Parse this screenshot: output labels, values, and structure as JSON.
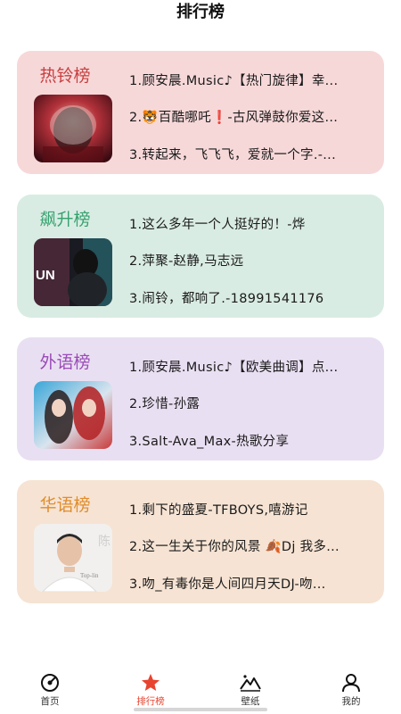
{
  "header": {
    "title": "排行榜"
  },
  "charts": [
    {
      "title": "热铃榜",
      "title_color": "#c84040",
      "background": "#f7d8d9",
      "songs": [
        "1.顾安晨.Music♪【热门旋律】幸...",
        "2.🐯百酷哪吒❗-古风弹鼓你爱这...",
        "3.转起来，飞飞飞，爱就一个字.-..."
      ]
    },
    {
      "title": "飙升榜",
      "title_color": "#36a26f",
      "background": "#d9ece3",
      "songs": [
        "1.这么多年一个人挺好的！-烨",
        "2.萍聚-赵静,马志远",
        "3.闹铃，都响了.-18991541176"
      ]
    },
    {
      "title": "外语榜",
      "title_color": "#9a4bb8",
      "background": "#e9dff2",
      "songs": [
        "1.顾安晨.Music♪【欧美曲调】点...",
        "2.珍惜-孙露",
        "3.Salt-Ava_Max-热歌分享"
      ]
    },
    {
      "title": "华语榜",
      "title_color": "#e08d2c",
      "background": "#f6e3d3",
      "songs": [
        "1.剩下的盛夏-TFBOYS,嘻游记",
        "2.这一生关于你的风景 🍂Dj 我多...",
        "3.吻_有毒你是人间四月天DJ-吻..."
      ]
    }
  ],
  "covers": {
    "rise_cover_text": "UN",
    "cn_cover_text": "Top-lin"
  },
  "tabbar": {
    "items": [
      {
        "label": "首页",
        "icon": "music-disc-icon"
      },
      {
        "label": "排行榜",
        "icon": "star-icon",
        "active": true
      },
      {
        "label": "壁纸",
        "icon": "mountain-icon"
      },
      {
        "label": "我的",
        "icon": "user-icon"
      }
    ],
    "accent": "#e8432f"
  }
}
